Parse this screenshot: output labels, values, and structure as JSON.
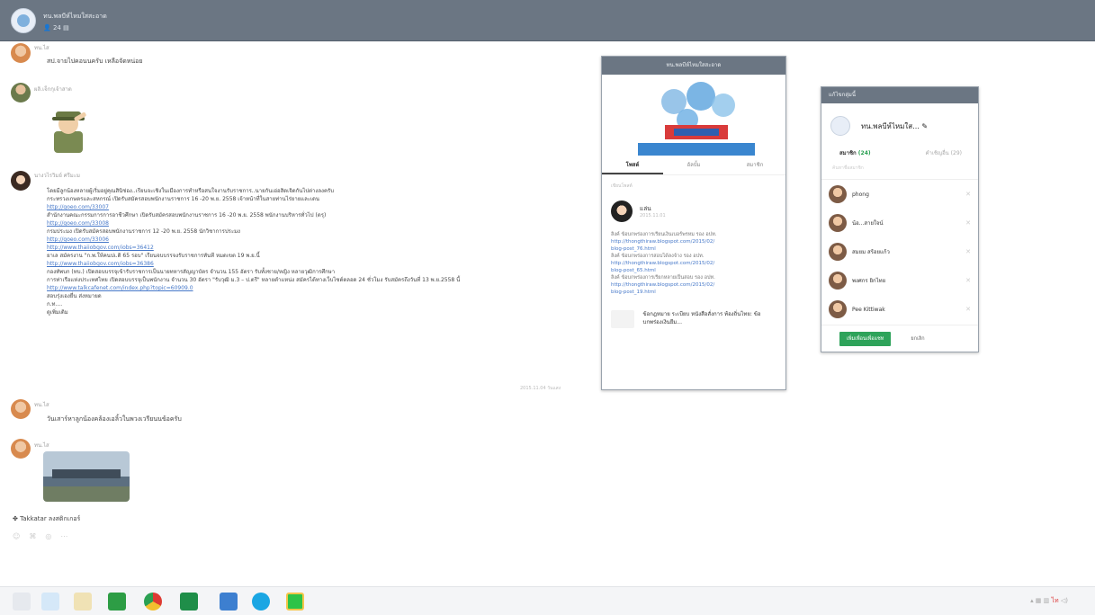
{
  "window": {
    "title": "ทน.พลบีห์ไหมใสสะอาด",
    "member_count": "24"
  },
  "chat": [
    {
      "sender": "ทน.ไส",
      "text": "สป.จายไปคอนนครับ เหลือจัดหน่อย"
    },
    {
      "sender": "ผลิ.เจ็กกุเจ้าสาด",
      "sticker": "soldier-salute"
    },
    {
      "sender": "นางวไรวิมย์ ศรีมะม",
      "lines": [
        {
          "text": "โดยมีลูกน้องหลายผู้เริ่มอยู่คุณสินิช่อง..เรียนจะเชิงในเมืองการทำหรือสนใจงานรับราชการ..นายกันเอ่อสิดเจิดกันไปต่างลงครับ",
          "link": false
        },
        {
          "text": "กระทรวงเกษตรและสหกรณ์ เปิดรับสมัครสอบพนักงานราชการ 16 -20 พ.ย. 2558 เจ้าหน้าที่ในสายท่านไร่ยายและเดน",
          "link": false
        },
        {
          "text": "http://goeo.com/33007",
          "link": true
        },
        {
          "text": "สำนักงานคณะกรรมการการอาชีวศึกษา เปิดรับสมัครสอบพนักงานราชการ 16 -20 พ.ย. 2558 พนักงานบริหารทั่วไป (ดรุ)",
          "link": false
        },
        {
          "text": "http://goeo.com/33008",
          "link": true
        },
        {
          "text": "กรมประมง เปิดรับสมัครสอบพนักงานราชการ 12 -20 พ.ย. 2558 นักวิชาการประมง",
          "link": false
        },
        {
          "text": "http://goeo.com/33006",
          "link": true
        },
        {
          "text": "http://www.thaiiobgov.com/iobs=36412",
          "link": true
        },
        {
          "text": "ยาเล สมัครงาน \"ก.พ.ให้คนปเ.ดิ 65 รอบ\" เรียนจบบรรจงรับราชการทันที หมดเขต 19 พ.ย.นี้",
          "link": false
        },
        {
          "text": "http://www.thaiiobgov.com/iobs=36386",
          "link": true
        },
        {
          "text": "กองทัพบก (ทบ.) เปิดสอบบรรจุเข้ารับราชการเป็นนายทหารสัญญาบัตร จำนวน 155 อัตรา รับทั้งชาย/หญิง หลายวุฒิการศึกษา",
          "link": false
        },
        {
          "text": "การท่าเรือแห่งประเทศไทย เปิดสอบบรรจุเป็นพนักงาน จำนวน 30 อัตรา \"รับวุฒิ ม.3 – ป.ตรี\" หลายตำแหน่ง สมัครได้ทางเว็บไซต์ตลอด 24 ชั่วโมง รับสมัครถึงวันที่ 13 พ.ย.2558 นี้",
          "link": false
        },
        {
          "text": "http://www.talkcafenet.com/index.php?topic=60909.0",
          "link": true
        },
        {
          "text": "สอบรุ่งเองยื่น ส่งหมายด",
          "link": false
        },
        {
          "text": "ก.ท....",
          "link": false
        },
        {
          "text": "",
          "link": false
        },
        {
          "text": "ดูเพิ่มเติม",
          "link": false
        }
      ],
      "time": "2015.11.04 วันแสง"
    },
    {
      "sender": "ทน.ไส",
      "text": "วันเสาร์หาลูกน้องคล้องเอลิ้วในพวงเวรียนนข้อครับ"
    },
    {
      "sender": "ทน.ไส",
      "photo": "building-photo"
    }
  ],
  "bottom_line": "Takkatar ลงสติกเกอร์",
  "profile": {
    "header": "ทน.พลบีห์ไหมใสสะอาด",
    "tabs": [
      "โพสต์",
      "อัลบั้ม",
      "สมาชิก"
    ],
    "write_placeholder": "เขียนโพสต์",
    "post_author": "แล่น",
    "post_time": "2015.11.01",
    "post_lines": [
      {
        "text": "ลิงค์ ข้อบกพร่องการเรียนเงินเบอร์พรหม รอง อปท.",
        "link": false
      },
      {
        "text": "http://thongthiraw.blogspot.com/2015/02/",
        "link": true
      },
      {
        "text": "blog-post_76.html",
        "link": true
      },
      {
        "text": "ลิงค์ ข้อบกพร่องการสอบได้ลงจ้าง รอง อปท.",
        "link": false
      },
      {
        "text": "http://thongthiraw.blogspot.com/2015/02/",
        "link": true
      },
      {
        "text": "blog-post_65.html",
        "link": true
      },
      {
        "text": "ลิงค์ ข้อบกพร่องการเรียกหลายเป็นสอบ รอง อปท.",
        "link": false
      },
      {
        "text": "http://thongthiraw.blogspot.com/2015/02/",
        "link": true
      },
      {
        "text": "blog-post_19.html",
        "link": true
      }
    ],
    "link_preview": "ข้อกฎหมาย ระเบียบ หนังสือสั่งการ ท้องถิ่นไทย: ข้อบกพร่องเงินยืม..."
  },
  "members_window": {
    "header": "แก้ไขกลุ่มนี้",
    "group_name": "ทน.พลบีห์ไหมใส...",
    "tab_members_label": "สมาชิก",
    "tab_members_count": "(24)",
    "tab_invited_label": "คำเชิญอื่น (29)",
    "search_placeholder": "ค้นหาชื่อสมาชิก",
    "members": [
      "phong",
      "น้อ...สายใจน์",
      "สมยม สร้อยแก้ว",
      "พงศกร ยิกไทย",
      "Pee Kittiwak"
    ],
    "add_button": "เพิ่มเพื่อนเพื่อแชท",
    "cancel": "ยกเลิก"
  },
  "taskbar": {
    "tray_text": "ไท"
  }
}
